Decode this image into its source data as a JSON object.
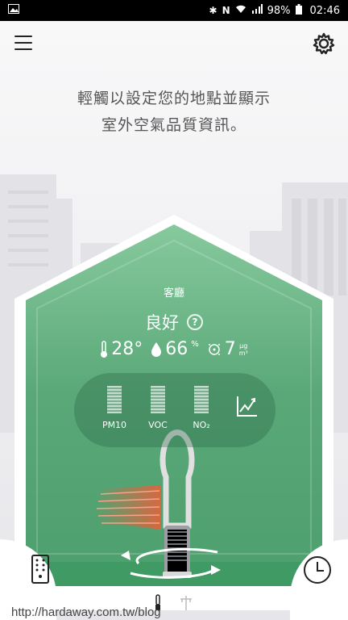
{
  "status_bar": {
    "battery": "98%",
    "time": "02:46"
  },
  "header": {
    "menu_icon": "hamburger-menu-icon",
    "settings_icon": "gear-icon"
  },
  "prompt": {
    "line1": "輕觸以設定您的地點並顯示",
    "line2": "室外空氣品質資訊。"
  },
  "room": {
    "name": "客廳",
    "quality": "良好",
    "temperature": "28°",
    "humidity": "66",
    "humidity_unit": "%",
    "particulates": "7",
    "particulates_unit_top": "μg",
    "particulates_unit_bottom": "m³"
  },
  "sensors": [
    {
      "label": "PM10"
    },
    {
      "label": "VOC"
    },
    {
      "label": "NO₂"
    }
  ],
  "colors": {
    "house_green_light": "#7ec595",
    "house_green_dark": "#2f8f57",
    "heat_orange": "#e8603a"
  },
  "watermark": "http://hardaway.com.tw/blog"
}
